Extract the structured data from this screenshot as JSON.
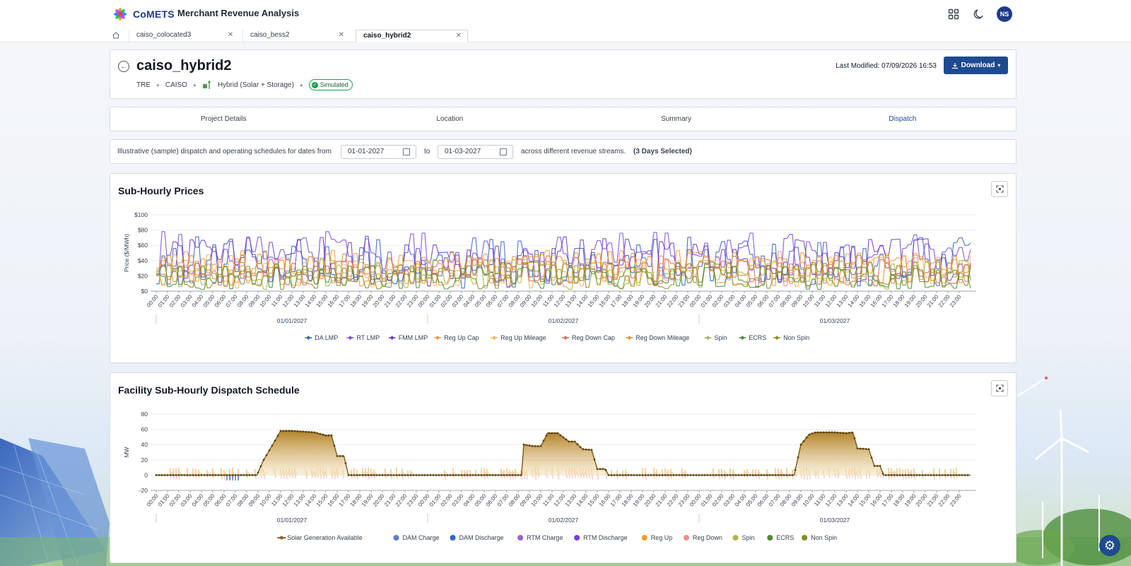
{
  "app": {
    "brand": "CoMETS",
    "title": "Merchant Revenue Analysis",
    "user_initials": "NS"
  },
  "tabs": [
    {
      "label": "caiso_colocated3"
    },
    {
      "label": "caiso_bess2"
    },
    {
      "label": "caiso_hybrid2",
      "active": true
    }
  ],
  "project": {
    "name": "caiso_hybrid2",
    "region": "TRE",
    "market": "CAISO",
    "type": "Hybrid (Solar + Storage)",
    "status": "Simulated",
    "last_modified": "Last Modified: 07/09/2026 16:53",
    "download_label": "Download"
  },
  "nav": [
    "Project Details",
    "Location",
    "Summary",
    "Dispatch"
  ],
  "nav_active": "Dispatch",
  "filter": {
    "prefix": "Illustrative (sample) dispatch and operating schedules for dates from",
    "from": "01-01-2027",
    "to_word": "to",
    "to": "01-03-2027",
    "suffix": "across different revenue streams.",
    "days": "(3 Days Selected)"
  },
  "colors": {
    "accent": "#1e4b8f",
    "status_green": "#16a34a"
  },
  "chart_data": [
    {
      "type": "line",
      "title": "Sub-Hourly Prices",
      "ylabel": "Price ($/MWh)",
      "ylim": [
        0,
        100
      ],
      "yticks": [
        "$100",
        "$80",
        "$60",
        "$40",
        "$20",
        "$0"
      ],
      "x_hours": [
        "00:00",
        "01:00",
        "02:00",
        "03:00",
        "04:00",
        "05:00",
        "06:00",
        "07:00",
        "08:00",
        "09:00",
        "10:00",
        "11:00",
        "12:00",
        "13:00",
        "14:00",
        "15:00",
        "16:00",
        "17:00",
        "18:00",
        "19:00",
        "20:00",
        "21:00",
        "22:00",
        "23:00"
      ],
      "x_days": [
        "01/01/2027",
        "01/02/2027",
        "01/03/2027"
      ],
      "legend": "bottom-center",
      "series": [
        {
          "name": "DA LMP",
          "color": "#3b63c4",
          "shape": "diamond",
          "center": 38,
          "amp": 34
        },
        {
          "name": "RT LMP",
          "color": "#7b4fd6",
          "shape": "diamond",
          "center": 45,
          "amp": 34
        },
        {
          "name": "FMM LMP",
          "color": "#6a3fc8",
          "shape": "diamond",
          "center": 42,
          "amp": 30
        },
        {
          "name": "Reg Up Cap",
          "color": "#f39a3a",
          "shape": "diamond",
          "center": 30,
          "amp": 24
        },
        {
          "name": "Reg Up Mileage",
          "color": "#f3b45a",
          "shape": "diamond",
          "center": 26,
          "amp": 22
        },
        {
          "name": "Reg Down Cap",
          "color": "#e06a55",
          "shape": "diamond",
          "center": 24,
          "amp": 18
        },
        {
          "name": "Reg Down Mileage",
          "color": "#f08c30",
          "shape": "diamond",
          "center": 30,
          "amp": 22
        },
        {
          "name": "Spin",
          "color": "#a6b84a",
          "shape": "diamond",
          "center": 22,
          "amp": 20
        },
        {
          "name": "ECRS",
          "color": "#4d8d3a",
          "shape": "diamond",
          "center": 18,
          "amp": 16
        },
        {
          "name": "Non Spin",
          "color": "#8a8a2a",
          "shape": "diamond",
          "center": 20,
          "amp": 18
        }
      ]
    },
    {
      "type": "area",
      "title": "Facility Sub-Hourly Dispatch Schedule",
      "ylabel": "MW",
      "ylim": [
        -20,
        80
      ],
      "yticks": [
        "80",
        "60",
        "40",
        "20",
        "0",
        "-20"
      ],
      "x_hours": [
        "00:00",
        "01:00",
        "02:00",
        "03:00",
        "04:00",
        "05:00",
        "06:00",
        "07:00",
        "08:00",
        "09:00",
        "10:00",
        "11:00",
        "12:00",
        "13:00",
        "14:00",
        "15:00",
        "16:00",
        "17:00",
        "18:00",
        "19:00",
        "20:00",
        "21:00",
        "22:00",
        "23:00"
      ],
      "x_days": [
        "01/01/2027",
        "01/02/2027",
        "01/03/2027"
      ],
      "legend": "bottom-center",
      "solar_profile": [
        {
          "day": 0,
          "points": [
            [
              0,
              0
            ],
            [
              8.9,
              0
            ],
            [
              9.5,
              20
            ],
            [
              10.3,
              40
            ],
            [
              11,
              58
            ],
            [
              12,
              58
            ],
            [
              13,
              57
            ],
            [
              14,
              56
            ],
            [
              15,
              52
            ],
            [
              15.5,
              52
            ],
            [
              16,
              25
            ],
            [
              16.6,
              25
            ],
            [
              17,
              0
            ],
            [
              24,
              0
            ]
          ]
        },
        {
          "day": 1,
          "points": [
            [
              0,
              0
            ],
            [
              8.3,
              0
            ],
            [
              8.5,
              40
            ],
            [
              9.3,
              38
            ],
            [
              10,
              38
            ],
            [
              10.6,
              55
            ],
            [
              11.5,
              55
            ],
            [
              12.5,
              44
            ],
            [
              13,
              44
            ],
            [
              13.7,
              34
            ],
            [
              14.5,
              33
            ],
            [
              15,
              8
            ],
            [
              15.7,
              8
            ],
            [
              16,
              0
            ],
            [
              24,
              0
            ]
          ]
        },
        {
          "day": 2,
          "points": [
            [
              0,
              0
            ],
            [
              8.4,
              0
            ],
            [
              9,
              40
            ],
            [
              9.7,
              53
            ],
            [
              10.3,
              56
            ],
            [
              12,
              56
            ],
            [
              13,
              55
            ],
            [
              13.6,
              56
            ],
            [
              14,
              35
            ],
            [
              15,
              34
            ],
            [
              15.5,
              12
            ],
            [
              16,
              12
            ],
            [
              16.3,
              0
            ],
            [
              24,
              0
            ]
          ]
        }
      ],
      "series": [
        {
          "name": "Solar Generation Available",
          "color": "#8a6418"
        },
        {
          "name": "DAM Charge",
          "color": "#5b7fce"
        },
        {
          "name": "DAM Discharge",
          "color": "#2f65c8"
        },
        {
          "name": "RTM Charge",
          "color": "#9a63cf"
        },
        {
          "name": "RTM Discharge",
          "color": "#7c3aed"
        },
        {
          "name": "Reg Up",
          "color": "#f59a2f"
        },
        {
          "name": "Reg Down",
          "color": "#f08f8f"
        },
        {
          "name": "Spin",
          "color": "#b5b44a"
        },
        {
          "name": "ECRS",
          "color": "#4e8a2e"
        },
        {
          "name": "Non Spin",
          "color": "#8a8a1f"
        }
      ]
    }
  ]
}
